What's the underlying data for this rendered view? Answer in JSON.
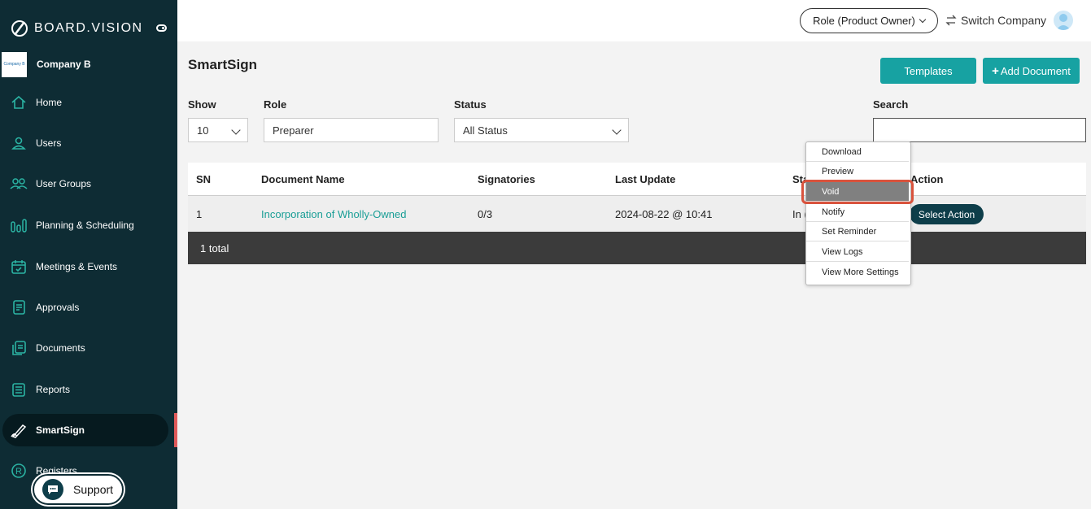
{
  "app": {
    "brand": "BOARD.VISION"
  },
  "company": {
    "name": "Company B",
    "logo_text": "Company B"
  },
  "sidebar": {
    "items": [
      {
        "label": "Home",
        "icon": "home-icon"
      },
      {
        "label": "Users",
        "icon": "user-icon"
      },
      {
        "label": "User Groups",
        "icon": "users-icon"
      },
      {
        "label": "Planning & Scheduling",
        "icon": "bar-chart-icon"
      },
      {
        "label": "Meetings & Events",
        "icon": "calendar-icon"
      },
      {
        "label": "Approvals",
        "icon": "document-icon"
      },
      {
        "label": "Documents",
        "icon": "documents-icon"
      },
      {
        "label": "Reports",
        "icon": "list-icon"
      },
      {
        "label": "SmartSign",
        "icon": "pen-icon",
        "active": true
      },
      {
        "label": "Registers",
        "icon": "registered-icon"
      }
    ]
  },
  "support": {
    "label": "Support"
  },
  "topbar": {
    "role_label": "Role (Product Owner)",
    "switch_label": "Switch Company"
  },
  "page": {
    "title": "SmartSign",
    "templates_button": "Templates",
    "add_document_button": "Add Document"
  },
  "filters": {
    "show_label": "Show",
    "show_value": "10",
    "role_label": "Role",
    "role_value": "Preparer",
    "status_label": "Status",
    "status_value": "All Status",
    "search_label": "Search",
    "search_value": ""
  },
  "table": {
    "headers": {
      "sn": "SN",
      "document_name": "Document Name",
      "signatories": "Signatories",
      "last_update": "Last Update",
      "status": "Sta",
      "action": "Action"
    },
    "rows": [
      {
        "sn": "1",
        "document_name": "Incorporation of Wholly-Owned",
        "signatories": "0/3",
        "last_update": "2024-08-22 @ 10:41",
        "status": "In (",
        "action": "Select Action"
      }
    ],
    "footer": "1 total"
  },
  "action_menu": {
    "items": [
      "Download",
      "Preview",
      "Void",
      "Notify",
      "Set Reminder",
      "View Logs",
      "View More Settings"
    ],
    "highlighted": "Void"
  },
  "colors": {
    "sidebar_bg": "#0e2c34",
    "accent_teal": "#17a2a2",
    "link_teal": "#1a9e96",
    "highlight_outline": "#d9533d"
  }
}
